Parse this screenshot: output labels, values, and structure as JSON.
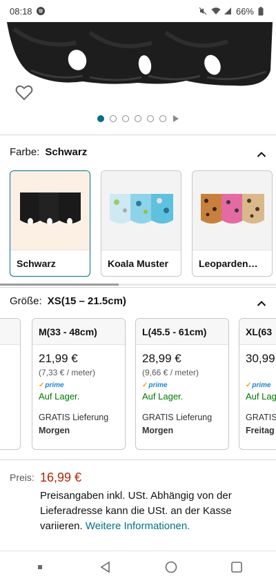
{
  "status_bar": {
    "time": "08:18",
    "battery": "66%",
    "icons": [
      "spotify-icon",
      "mute-icon",
      "wifi-icon",
      "signal-icon",
      "battery-icon"
    ]
  },
  "gallery": {
    "dot_count": 6,
    "active_index": 0
  },
  "color": {
    "label": "Farbe:",
    "selected": "Schwarz",
    "options": [
      {
        "name": "Schwarz"
      },
      {
        "name": "Koala Muster"
      },
      {
        "name": "Leoparden…"
      }
    ]
  },
  "size": {
    "label": "Größe:",
    "selected": "XS(15 – 21.5cm)",
    "options": [
      {
        "name": "M(33 - 48cm)",
        "price": "21,99 €",
        "unit": "(7,33 € / meter)",
        "prime": "prime",
        "stock": "Auf Lager.",
        "shipping": "GRATIS Lieferung",
        "day": "Morgen"
      },
      {
        "name": "L(45.5 - 61cm)",
        "price": "28,99 €",
        "unit": "(9,66 € / meter)",
        "prime": "prime",
        "stock": "Auf Lager.",
        "shipping": "GRATIS Lieferung",
        "day": "Morgen"
      },
      {
        "name": "XL(63",
        "price": "30,99",
        "prime": "prime",
        "stock": "Auf Lag",
        "shipping": "GRATIS",
        "day": "Freitag"
      }
    ]
  },
  "price": {
    "label": "Preis:",
    "value": "16,99 €",
    "note": "Preisangaben inkl. USt. Abhängig von der Lieferadresse kann die USt. an der Kasse variieren.",
    "link": "Weitere Informationen."
  },
  "colors": {
    "accent": "#007185",
    "price": "#b12704",
    "in_stock": "#007600",
    "prime_blue": "#1f85c8"
  }
}
